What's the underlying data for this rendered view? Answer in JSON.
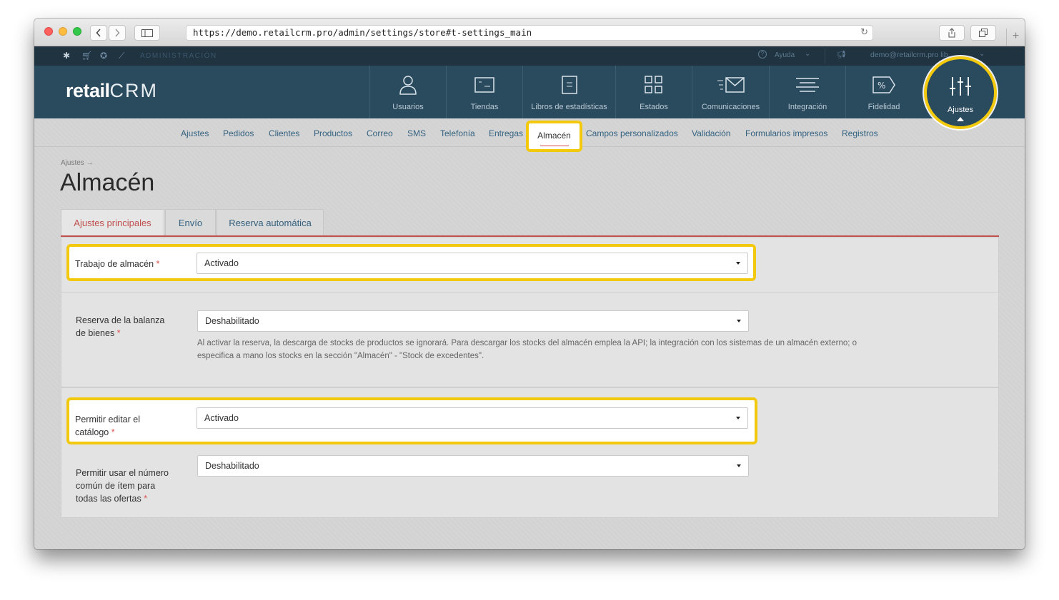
{
  "browser": {
    "url": "https://demo.retailcrm.pro/admin/settings/store#t-settings_main",
    "back_icon": "chevron-left-icon",
    "forward_icon": "chevron-right-icon"
  },
  "adminbar": {
    "label": "ADMINISTRACIÓN",
    "help": "Ayuda",
    "user": "demo@retailcrm.pro  lib..."
  },
  "header": {
    "logo": "retail",
    "logo_crm": "CRM",
    "nav": [
      {
        "label": "Usuarios",
        "icon": "user-icon"
      },
      {
        "label": "Tiendas",
        "icon": "store-window-icon"
      },
      {
        "label": "Libros de estadísticas",
        "icon": "document-icon"
      },
      {
        "label": "Estados",
        "icon": "grid-icon"
      },
      {
        "label": "Comunicaciones",
        "icon": "envelope-icon"
      },
      {
        "label": "Integración",
        "icon": "lines-icon"
      },
      {
        "label": "Fidelidad",
        "icon": "percent-tag-icon"
      },
      {
        "label": "Ajustes",
        "icon": "sliders-icon"
      }
    ]
  },
  "subnav": {
    "items": [
      "Ajustes",
      "Pedidos",
      "Clientes",
      "Productos",
      "Correo",
      "SMS",
      "Telefonía",
      "Entregas",
      "Almacén",
      "Campos personalizados",
      "Validación",
      "Formularios impresos",
      "Registros"
    ],
    "active": "Almacén"
  },
  "page": {
    "breadcrumb": "Ajustes →",
    "title": "Almacén",
    "tabs": [
      "Ajustes principales",
      "Envío",
      "Reserva automática"
    ],
    "active_tab": "Ajustes principales"
  },
  "form": {
    "required_mark": "*",
    "warehouse_work": {
      "label": "Trabajo de almacén",
      "value": "Activado"
    },
    "reserve_balance": {
      "label_line1": "Reserva de la balanza",
      "label_line2": "de bienes",
      "value": "Deshabilitado",
      "hint_line1": "Al activar la reserva, la descarga de stocks de productos se ignorará. Para descargar los stocks del almacén emplea la API; la integración con los sistemas de un almacén externo; o",
      "hint_line2": "especifica a mano los stocks en la sección \"Almacén\" - \"Stock de excedentes\"."
    },
    "edit_catalog": {
      "label_line1": "Permitir editar el",
      "label_line2": "catálogo",
      "value": "Activado"
    },
    "common_item_number": {
      "label_line1": "Permitir usar el número",
      "label_line2": "común de ítem para",
      "label_line3": "todas las ofertas",
      "value": "Deshabilitado"
    }
  },
  "colors": {
    "header": "#2a4a5e",
    "highlight": "#f2c90d",
    "active_tab": "#c0504d",
    "link": "#33617f"
  }
}
